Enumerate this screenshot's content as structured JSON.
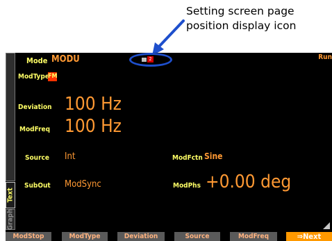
{
  "callout": {
    "line1": "Setting screen page",
    "line2": "position display icon"
  },
  "screen": {
    "run_status": "Run",
    "tabs": {
      "text": "Text",
      "graph": "Graph"
    },
    "page_icon_number": "2",
    "mode": {
      "label": "Mode",
      "value": "MODU"
    },
    "modtype": {
      "label": "ModType",
      "value": "FM"
    },
    "deviation": {
      "label": "Deviation",
      "value": "100 Hz"
    },
    "modfreq": {
      "label": "ModFreq",
      "value": "100 Hz"
    },
    "source": {
      "label": "Source",
      "value": "Int"
    },
    "modfctn": {
      "label": "ModFctn",
      "value": "Sine"
    },
    "subout": {
      "label": "SubOut",
      "value": "ModSync"
    },
    "modphs": {
      "label": "ModPhs",
      "value": "+0.00 deg"
    }
  },
  "softkeys": [
    "ModStop",
    "ModType",
    "Deviation",
    "Source",
    "ModFreq",
    "⇒Next"
  ],
  "colors": {
    "label_yellow": "#ffff66",
    "value_orange": "#ff9933",
    "highlight_ring_blue": "#1e4fcc",
    "next_key_orange": "#ff9900"
  }
}
